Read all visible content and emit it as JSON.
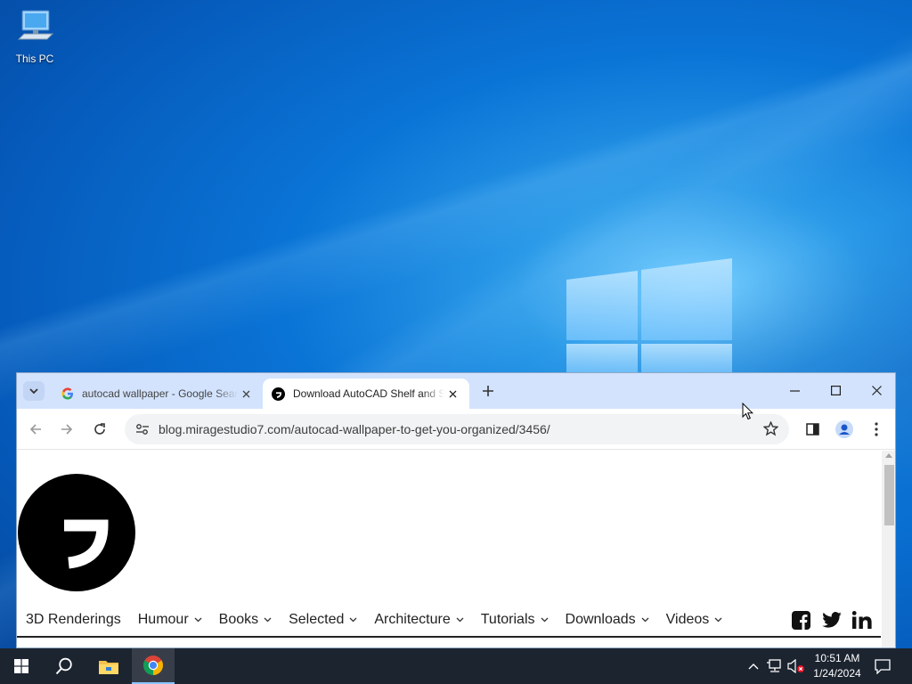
{
  "desktop": {
    "icons": [
      {
        "label": "This PC",
        "icon": "computer-icon"
      }
    ]
  },
  "browser": {
    "tabs": [
      {
        "title": "autocad wallpaper - Google Search",
        "favicon": "google-favicon",
        "active": false
      },
      {
        "title": "Download AutoCAD Shelf and Shelving",
        "favicon": "miragestudio-favicon",
        "active": true
      }
    ],
    "address_bar": {
      "url": "blog.miragestudio7.com/autocad-wallpaper-to-get-you-organized/3456/"
    },
    "colors": {
      "tabstrip": "#d3e3fd",
      "omnibox": "#f1f3f4"
    }
  },
  "site": {
    "nav_items": [
      {
        "label": "3D Renderings",
        "has_menu": false
      },
      {
        "label": "Humour",
        "has_menu": true
      },
      {
        "label": "Books",
        "has_menu": true
      },
      {
        "label": "Selected",
        "has_menu": true
      },
      {
        "label": "Architecture",
        "has_menu": true
      },
      {
        "label": "Tutorials",
        "has_menu": true
      },
      {
        "label": "Downloads",
        "has_menu": true
      },
      {
        "label": "Videos",
        "has_menu": true
      }
    ],
    "social": [
      "facebook-icon",
      "twitter-icon",
      "linkedin-icon"
    ]
  },
  "taskbar": {
    "clock": {
      "time": "10:51 AM",
      "date": "1/24/2024"
    },
    "background": "#1c2430"
  }
}
